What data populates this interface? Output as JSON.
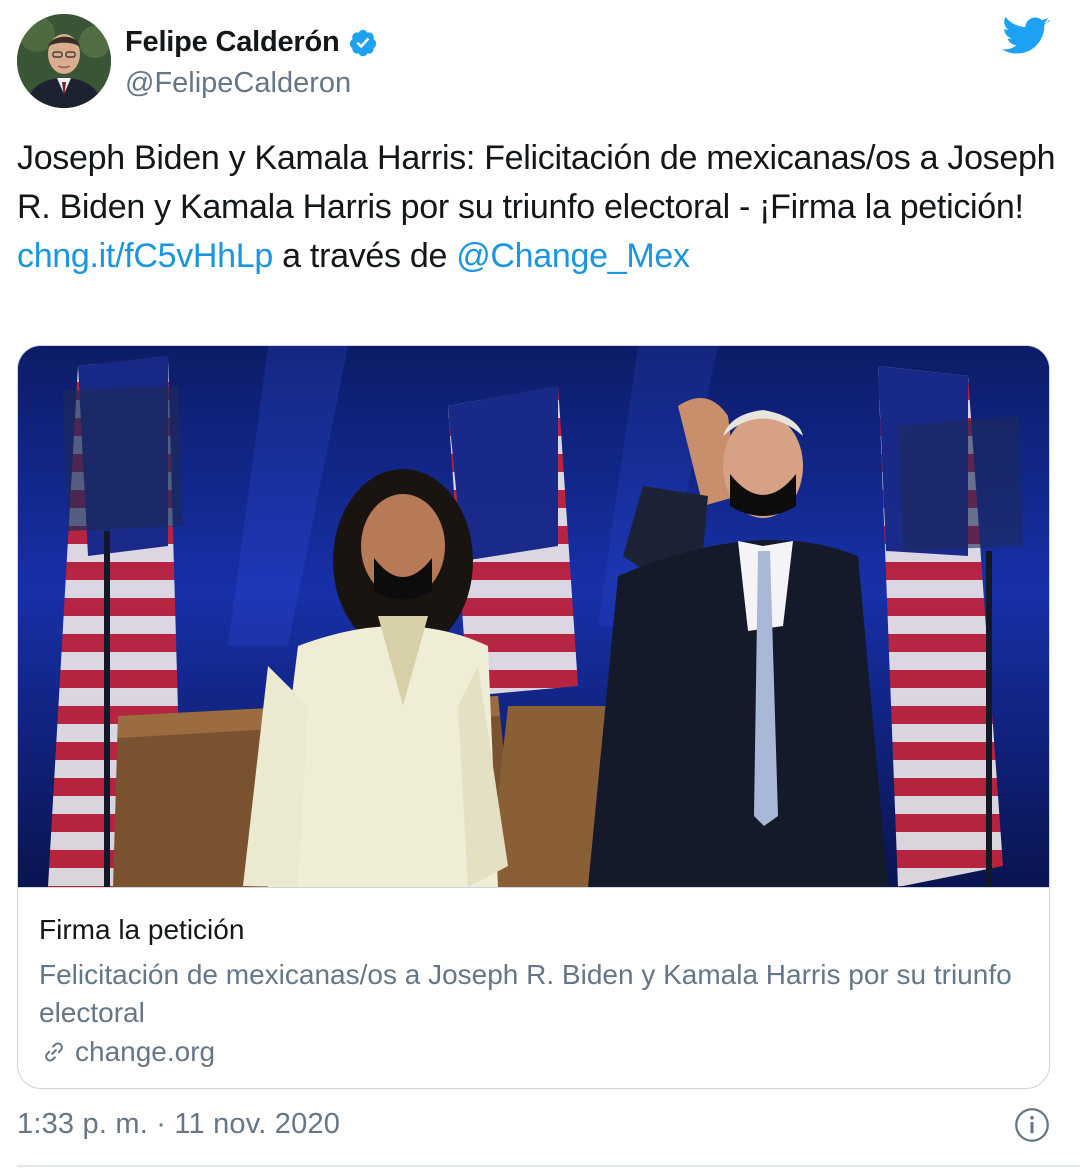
{
  "author": {
    "display_name": "Felipe Calderón",
    "handle": "@FelipeCalderon",
    "verified": true,
    "avatar_icon": "user-avatar"
  },
  "brand": {
    "icon": "twitter-bird-icon",
    "color": "#1da1f2"
  },
  "tweet": {
    "text_part1": "Joseph Biden y Kamala Harris: Felicitación de mexicanas/os a Joseph R. Biden y Kamala Harris por su triunfo electoral - ¡Firma la petición! ",
    "link": "chng.it/fC5vHhLp",
    "text_part2": " a través de ",
    "mention": "@Change_Mex",
    "link_color": "#1b95e0"
  },
  "card": {
    "image_icon": "card-photo",
    "title": "Firma la petición",
    "description": "Felicitación de mexicanas/os a Joseph R. Biden y Kamala Harris por su triunfo electoral",
    "domain": "change.org",
    "domain_icon": "link-icon"
  },
  "footer": {
    "timestamp": "1:33 p. m. · 11 nov. 2020",
    "info_icon": "info-icon"
  },
  "colors": {
    "text_primary": "#14171a",
    "text_secondary": "#657786",
    "border": "#ccd6dd"
  }
}
